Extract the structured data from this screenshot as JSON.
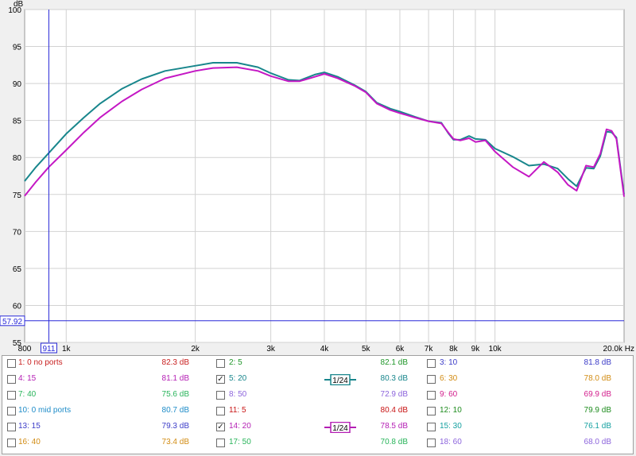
{
  "chart_data": {
    "type": "line",
    "ylabel": "dB",
    "xunit": "Hz",
    "xscale": "log",
    "xlim": [
      800,
      20000
    ],
    "ylim": [
      55,
      100
    ],
    "yticks": [
      55,
      60,
      65,
      70,
      75,
      80,
      85,
      90,
      95,
      100
    ],
    "xticks": [
      {
        "v": 1000,
        "label": "1k"
      },
      {
        "v": 2000,
        "label": "2k"
      },
      {
        "v": 3000,
        "label": "3k"
      },
      {
        "v": 4000,
        "label": "4k"
      },
      {
        "v": 5000,
        "label": "5k"
      },
      {
        "v": 6000,
        "label": "6k"
      },
      {
        "v": 7000,
        "label": "7k"
      },
      {
        "v": 8000,
        "label": "8k"
      },
      {
        "v": 9000,
        "label": "9k"
      },
      {
        "v": 10000,
        "label": "10k"
      },
      {
        "v": 20000,
        "label": "20.0k Hz"
      }
    ],
    "xstart_label": "800",
    "cursor": {
      "x": 911,
      "x_label": "911",
      "y": 57.92,
      "y_label": "57.92"
    },
    "grid": true,
    "series": [
      {
        "color": "#18868c",
        "points": [
          [
            800,
            76.8
          ],
          [
            850,
            78.7
          ],
          [
            911,
            80.6
          ],
          [
            1000,
            83.2
          ],
          [
            1100,
            85.4
          ],
          [
            1200,
            87.3
          ],
          [
            1350,
            89.3
          ],
          [
            1500,
            90.6
          ],
          [
            1700,
            91.7
          ],
          [
            2000,
            92.4
          ],
          [
            2200,
            92.8
          ],
          [
            2500,
            92.8
          ],
          [
            2800,
            92.2
          ],
          [
            3000,
            91.4
          ],
          [
            3300,
            90.5
          ],
          [
            3500,
            90.4
          ],
          [
            3800,
            91.2
          ],
          [
            4000,
            91.5
          ],
          [
            4300,
            90.9
          ],
          [
            4700,
            89.8
          ],
          [
            5000,
            88.9
          ],
          [
            5300,
            87.4
          ],
          [
            5700,
            86.6
          ],
          [
            6000,
            86.2
          ],
          [
            6500,
            85.5
          ],
          [
            7000,
            84.9
          ],
          [
            7500,
            84.7
          ],
          [
            7800,
            83.2
          ],
          [
            8000,
            82.4
          ],
          [
            8300,
            82.4
          ],
          [
            8700,
            82.9
          ],
          [
            9000,
            82.5
          ],
          [
            9500,
            82.4
          ],
          [
            10000,
            81.2
          ],
          [
            11000,
            80.1
          ],
          [
            12000,
            78.9
          ],
          [
            13000,
            79.1
          ],
          [
            14000,
            78.5
          ],
          [
            14800,
            77.1
          ],
          [
            15500,
            76.1
          ],
          [
            16300,
            78.6
          ],
          [
            17000,
            78.5
          ],
          [
            17600,
            80.2
          ],
          [
            18200,
            83.5
          ],
          [
            18700,
            83.4
          ],
          [
            19200,
            82.7
          ],
          [
            20000,
            75.0
          ]
        ]
      },
      {
        "color": "#c417c4",
        "points": [
          [
            800,
            74.8
          ],
          [
            850,
            76.7
          ],
          [
            911,
            78.7
          ],
          [
            1000,
            81.0
          ],
          [
            1100,
            83.4
          ],
          [
            1200,
            85.4
          ],
          [
            1350,
            87.6
          ],
          [
            1500,
            89.2
          ],
          [
            1700,
            90.7
          ],
          [
            2000,
            91.7
          ],
          [
            2200,
            92.1
          ],
          [
            2500,
            92.2
          ],
          [
            2800,
            91.7
          ],
          [
            3000,
            91.0
          ],
          [
            3300,
            90.3
          ],
          [
            3500,
            90.3
          ],
          [
            3800,
            90.9
          ],
          [
            4000,
            91.3
          ],
          [
            4300,
            90.7
          ],
          [
            4700,
            89.7
          ],
          [
            5000,
            88.8
          ],
          [
            5300,
            87.3
          ],
          [
            5700,
            86.4
          ],
          [
            6000,
            86.0
          ],
          [
            6500,
            85.4
          ],
          [
            7000,
            84.9
          ],
          [
            7500,
            84.6
          ],
          [
            7800,
            83.3
          ],
          [
            8000,
            82.5
          ],
          [
            8300,
            82.3
          ],
          [
            8700,
            82.6
          ],
          [
            9000,
            82.1
          ],
          [
            9500,
            82.3
          ],
          [
            10000,
            80.8
          ],
          [
            11000,
            78.7
          ],
          [
            12000,
            77.4
          ],
          [
            13000,
            79.4
          ],
          [
            14000,
            78.0
          ],
          [
            14800,
            76.3
          ],
          [
            15500,
            75.5
          ],
          [
            16300,
            78.9
          ],
          [
            17000,
            78.7
          ],
          [
            17600,
            80.5
          ],
          [
            18200,
            83.8
          ],
          [
            18700,
            83.6
          ],
          [
            19200,
            82.5
          ],
          [
            20000,
            74.7
          ]
        ]
      }
    ]
  },
  "legend": [
    [
      {
        "checked": false,
        "label": "1: 0 no ports",
        "value": "82.3 dB",
        "color": "#c81e1e"
      },
      {
        "checked": false,
        "label": "2: 5",
        "value": "82.1 dB",
        "color": "#1e9628"
      },
      {
        "checked": false,
        "label": "3: 10",
        "value": "81.8 dB",
        "color": "#3c3cc8"
      }
    ],
    [
      {
        "checked": false,
        "label": "4: 15",
        "value": "81.1 dB",
        "color": "#b41eb4"
      },
      {
        "checked": true,
        "label": "5: 20",
        "value": "80.3 dB",
        "color": "#18868c",
        "smoothing": "1/24"
      },
      {
        "checked": false,
        "label": "6: 30",
        "value": "78.0 dB",
        "color": "#d28c14"
      }
    ],
    [
      {
        "checked": false,
        "label": "7: 40",
        "value": "75.6 dB",
        "color": "#28b45a"
      },
      {
        "checked": false,
        "label": "8: 50",
        "value": "72.9 dB",
        "color": "#8c64dc"
      },
      {
        "checked": false,
        "label": "9: 60",
        "value": "69.9 dB",
        "color": "#d21e8c"
      }
    ],
    [
      {
        "checked": false,
        "label": "10: 0 mid ports",
        "value": "80.7 dB",
        "color": "#1e8cc8"
      },
      {
        "checked": false,
        "label": "11: 5",
        "value": "80.4 dB",
        "color": "#c81414"
      },
      {
        "checked": false,
        "label": "12: 10",
        "value": "79.9 dB",
        "color": "#1e8c1e"
      }
    ],
    [
      {
        "checked": false,
        "label": "13: 15",
        "value": "79.3 dB",
        "color": "#3c3cc8"
      },
      {
        "checked": true,
        "label": "14: 20",
        "value": "78.5 dB",
        "color": "#b41eb4",
        "smoothing": "1/24"
      },
      {
        "checked": false,
        "label": "15: 30",
        "value": "76.1 dB",
        "color": "#14a0a0"
      }
    ],
    [
      {
        "checked": false,
        "label": "16: 40",
        "value": "73.4 dB",
        "color": "#d28c14"
      },
      {
        "checked": false,
        "label": "17: 50",
        "value": "70.8 dB",
        "color": "#28b45a"
      },
      {
        "checked": false,
        "label": "18: 60",
        "value": "68.0 dB",
        "color": "#8c64dc"
      }
    ]
  ]
}
